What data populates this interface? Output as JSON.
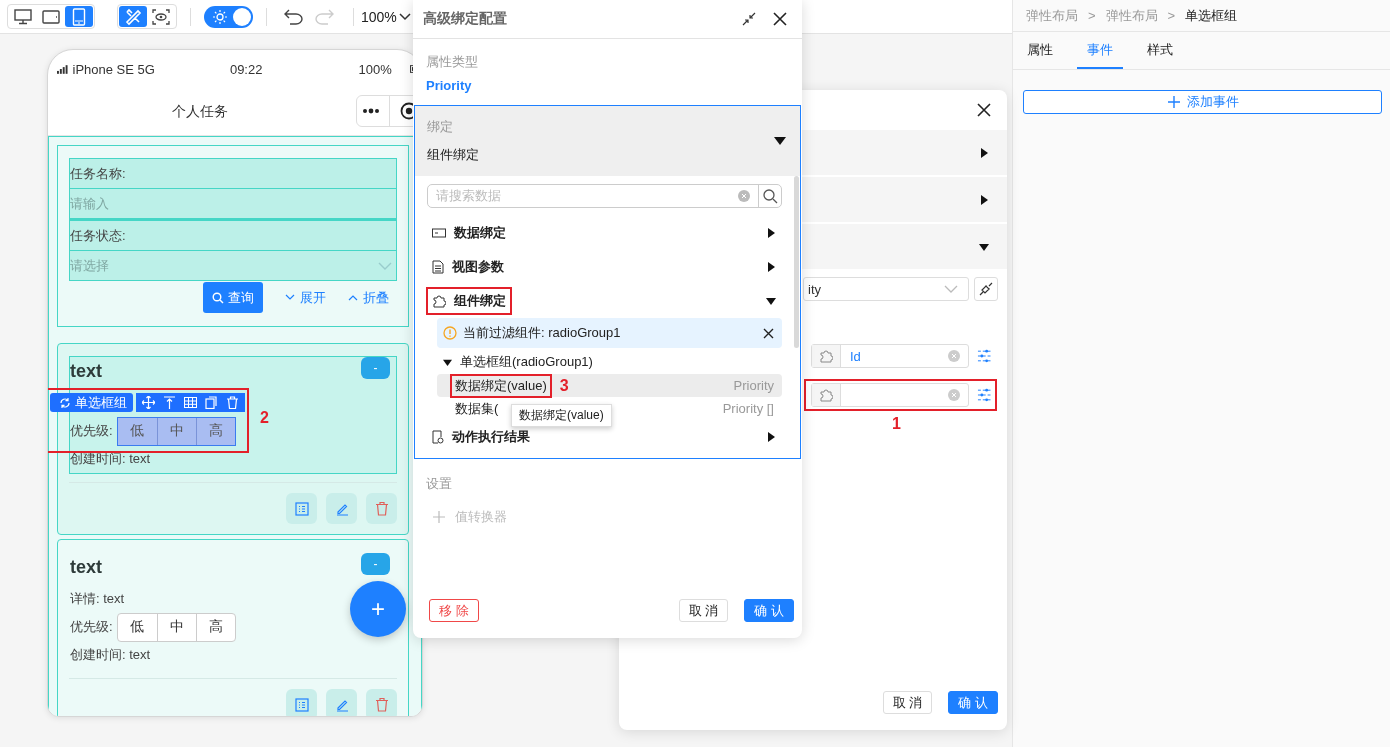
{
  "toolbar": {
    "devices": [
      {
        "kind": "desktop",
        "selected": false
      },
      {
        "kind": "tablet",
        "selected": false
      },
      {
        "kind": "phone",
        "selected": true
      }
    ],
    "modes": [
      {
        "kind": "design",
        "selected": true
      },
      {
        "kind": "preview",
        "selected": false
      }
    ],
    "theme_switch": {
      "on": true
    },
    "undo": {
      "disabled": false
    },
    "redo": {
      "disabled": true
    },
    "zoom": "100%"
  },
  "phone": {
    "carrier": "iPhone SE 5G",
    "time": "09:22",
    "battery": "100%",
    "title": "个人任务",
    "search_form": {
      "fields": [
        {
          "label": "任务名称:",
          "placeholder": "请输入",
          "kind": "input"
        },
        {
          "label": "任务状态:",
          "placeholder": "请选择",
          "kind": "select"
        }
      ],
      "buttons": [
        {
          "label": "查询",
          "kind": "primary"
        },
        {
          "label": "展开",
          "kind": "expand"
        },
        {
          "label": "折叠",
          "kind": "collapse"
        }
      ]
    },
    "cards": [
      {
        "title": "text",
        "badge": "-",
        "selected": true,
        "toolbar_label": "单选框组",
        "annotation": "2",
        "priority_label": "优先级:",
        "options": [
          {
            "label": "低",
            "selected": false
          },
          {
            "label": "中",
            "selected": false
          },
          {
            "label": "高",
            "selected": false
          }
        ],
        "created": "创建时间: text"
      },
      {
        "title": "text",
        "badge": "-",
        "selected": false,
        "detail": "详情: text",
        "priority_label": "优先级:",
        "options": [
          {
            "label": "低",
            "selected": false
          },
          {
            "label": "中",
            "selected": false
          },
          {
            "label": "高",
            "selected": false
          }
        ],
        "created": "创建时间: text"
      }
    ],
    "fab": "+"
  },
  "inspector": {
    "breadcrumb": [
      {
        "label": "弹性布局",
        "separator": ">",
        "current": false
      },
      {
        "label": "弹性布局",
        "separator": ">",
        "current": false
      },
      {
        "label": "单选框组",
        "current": true
      }
    ],
    "tabs": [
      {
        "label": "属性",
        "selected": false
      },
      {
        "label": "事件",
        "selected": true
      },
      {
        "label": "样式",
        "selected": false
      }
    ],
    "add_event": "添加事件"
  },
  "event_dialog": {
    "sections": [
      {
        "expanded": false
      },
      {
        "expanded": false
      },
      {
        "expanded": true
      }
    ],
    "select_value": "ity",
    "params": [
      {
        "value": "Id"
      },
      {
        "annotation": "1"
      }
    ],
    "buttons": [
      {
        "label": "取 消",
        "kind": "default"
      },
      {
        "label": "确 认",
        "kind": "primary"
      }
    ]
  },
  "binding_dialog": {
    "title": "高级绑定配置",
    "property_type_label": "属性类型",
    "property_type": "Priority",
    "binding_label": "绑定",
    "binding_value": "组件绑定",
    "search_placeholder": "请搜索数据",
    "tree": [
      {
        "kind": "data",
        "label": "数据绑定",
        "expanded": false,
        "marked": false
      },
      {
        "kind": "view",
        "label": "视图参数",
        "expanded": false,
        "marked": false
      },
      {
        "kind": "component",
        "label": "组件绑定",
        "expanded": true,
        "marked": true,
        "filter": "当前过滤组件: radioGroup1",
        "children": [
          {
            "label": "单选框组(radioGroup1)",
            "expanded": true,
            "children": [
              {
                "label": "数据绑定(value)",
                "type": "Priority",
                "selected": true,
                "annotation": "3"
              },
              {
                "label": "数据集(",
                "type": "Priority []",
                "selected": false
              }
            ]
          }
        ]
      },
      {
        "kind": "action",
        "label": "动作执行结果",
        "expanded": false,
        "marked": false
      }
    ],
    "tooltip": "数据绑定(value)",
    "settings_label": "设置",
    "converter": {
      "label": "值转换器",
      "disabled": true
    },
    "buttons": [
      {
        "label": "移 除",
        "kind": "danger"
      },
      {
        "label": "取 消",
        "kind": "default"
      },
      {
        "label": "确 认",
        "kind": "primary"
      }
    ]
  }
}
